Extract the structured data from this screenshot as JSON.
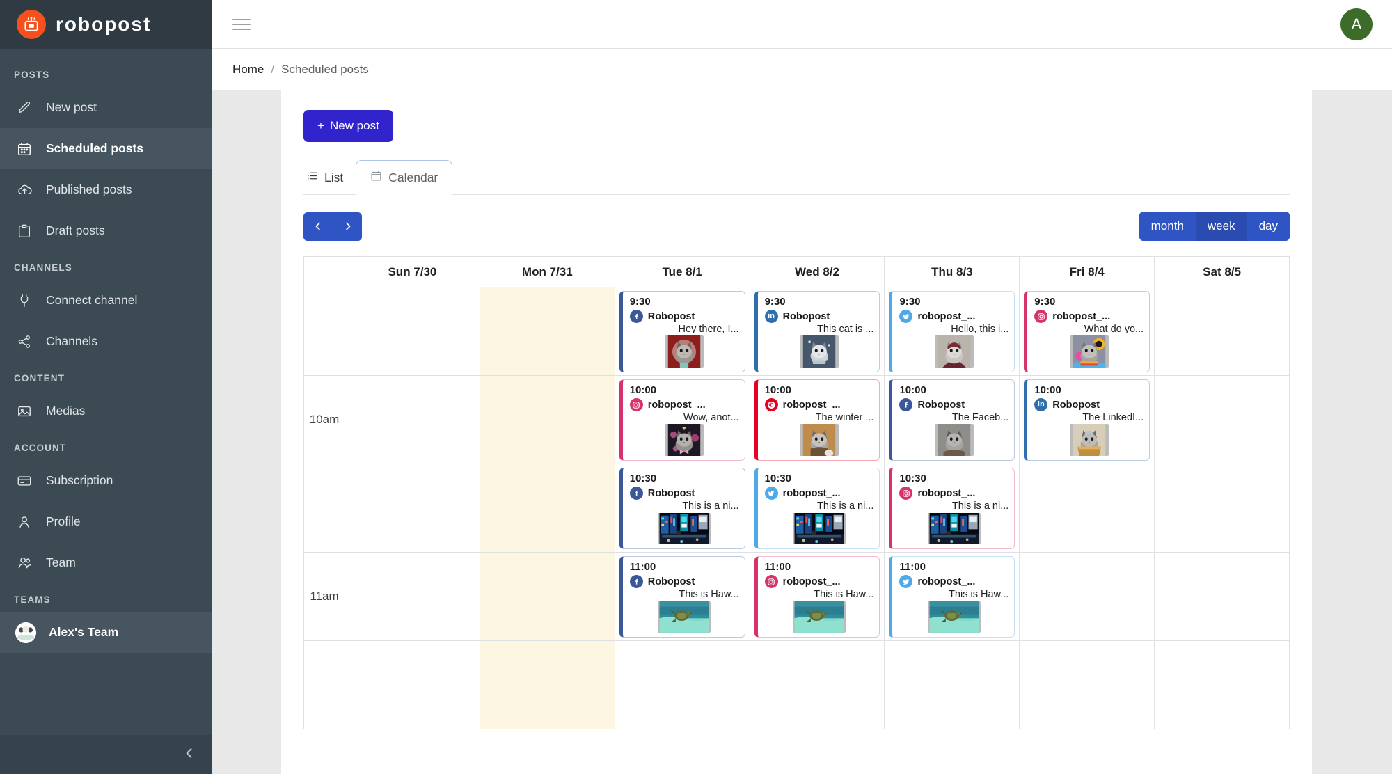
{
  "brand": {
    "name": "robopost",
    "logo_icon": "robot-logo-icon"
  },
  "sidebar": {
    "sections": [
      {
        "label": "POSTS",
        "items": [
          {
            "label": "New post",
            "icon": "pencil-icon",
            "active": false
          },
          {
            "label": "Scheduled posts",
            "icon": "calendar-icon",
            "active": true
          },
          {
            "label": "Published posts",
            "icon": "cloud-upload-icon",
            "active": false
          },
          {
            "label": "Draft posts",
            "icon": "clipboard-icon",
            "active": false
          }
        ]
      },
      {
        "label": "CHANNELS",
        "items": [
          {
            "label": "Connect channel",
            "icon": "plug-icon",
            "active": false
          },
          {
            "label": "Channels",
            "icon": "share-nodes-icon",
            "active": false
          }
        ]
      },
      {
        "label": "CONTENT",
        "items": [
          {
            "label": "Medias",
            "icon": "image-icon",
            "active": false
          }
        ]
      },
      {
        "label": "ACCOUNT",
        "items": [
          {
            "label": "Subscription",
            "icon": "credit-card-icon",
            "active": false
          },
          {
            "label": "Profile",
            "icon": "user-icon",
            "active": false
          },
          {
            "label": "Team",
            "icon": "users-icon",
            "active": false
          }
        ]
      },
      {
        "label": "TEAMS",
        "items": [
          {
            "label": "Alex's Team",
            "icon": "team-avatar-icon",
            "active": true
          }
        ]
      }
    ],
    "collapse_icon": "chevron-left-icon"
  },
  "topbar": {
    "menu_icon": "hamburger-menu-icon",
    "avatar_initial": "A",
    "avatar_color": "#3d6b2a"
  },
  "breadcrumb": {
    "home": "Home",
    "separator": "/",
    "current": "Scheduled posts"
  },
  "toolbar": {
    "new_post_label": "New post",
    "new_post_plus": "+",
    "new_post_color": "#3224cc"
  },
  "tabs": [
    {
      "label": "List",
      "icon": "list-icon",
      "active": false
    },
    {
      "label": "Calendar",
      "icon": "calendar-icon",
      "active": true
    }
  ],
  "calendar_nav": {
    "prev_icon": "chevron-left-icon",
    "next_icon": "chevron-right-icon",
    "views": [
      {
        "label": "month",
        "selected": false
      },
      {
        "label": "week",
        "selected": true
      },
      {
        "label": "day",
        "selected": false
      }
    ],
    "accent_color": "#2f55c5"
  },
  "calendar": {
    "days": [
      {
        "label": "Sun 7/30",
        "today": false
      },
      {
        "label": "Mon 7/31",
        "today": true
      },
      {
        "label": "Tue 8/1",
        "today": false
      },
      {
        "label": "Wed 8/2",
        "today": false
      },
      {
        "label": "Thu 8/3",
        "today": false
      },
      {
        "label": "Fri 8/4",
        "today": false
      },
      {
        "label": "Sat 8/5",
        "today": false
      }
    ],
    "time_labels": [
      "",
      "10am",
      "",
      "11am",
      ""
    ],
    "rows": [
      {
        "gutter": "",
        "half": false,
        "cells": [
          {
            "day": "Sun 7/30",
            "event": null
          },
          {
            "day": "Mon 7/31",
            "event": null
          },
          {
            "day": "Tue 8/1",
            "event": {
              "time": "9:30",
              "network": "facebook",
              "account": "Robopost",
              "text": "Hey there, I...",
              "thumb": "cat-red-backdrop",
              "color": "#3b5998"
            }
          },
          {
            "day": "Wed 8/2",
            "event": {
              "time": "9:30",
              "network": "linkedin",
              "account": "Robopost",
              "text": "This cat is ...",
              "thumb": "cat-snow-scarf",
              "color": "#2f6fad"
            }
          },
          {
            "day": "Thu 8/3",
            "event": {
              "time": "9:30",
              "network": "twitter",
              "account": "robopost_...",
              "text": "Hello, this i...",
              "thumb": "cat-red-robe",
              "color": "#4fa8e8"
            }
          },
          {
            "day": "Fri 8/4",
            "event": {
              "time": "9:30",
              "network": "instagram",
              "account": "robopost_...",
              "text": "What do yo...",
              "thumb": "cat-rainbow-graffiti",
              "color": "#d6336c"
            }
          },
          {
            "day": "Sat 8/5",
            "event": null
          }
        ]
      },
      {
        "gutter": "10am",
        "half": false,
        "cells": [
          {
            "day": "Sun 7/30",
            "event": null
          },
          {
            "day": "Mon 7/31",
            "event": null
          },
          {
            "day": "Tue 8/1",
            "event": {
              "time": "10:00",
              "network": "instagram",
              "account": "robopost_...",
              "text": "Wow, anot...",
              "thumb": "cat-pink-bowtie",
              "color": "#d6336c"
            }
          },
          {
            "day": "Wed 8/2",
            "event": {
              "time": "10:00",
              "network": "pinterest",
              "account": "robopost_...",
              "text": "The winter ...",
              "thumb": "cat-tan-coat",
              "color": "#e60023"
            }
          },
          {
            "day": "Thu 8/3",
            "event": {
              "time": "10:00",
              "network": "facebook",
              "account": "Robopost",
              "text": "The Faceb...",
              "thumb": "cat-grey-portrait",
              "color": "#3b5998"
            }
          },
          {
            "day": "Fri 8/4",
            "event": {
              "time": "10:00",
              "network": "linkedin",
              "account": "Robopost",
              "text": "The LinkedI...",
              "thumb": "cat-in-box",
              "color": "#2f6fad"
            }
          },
          {
            "day": "Sat 8/5",
            "event": null
          }
        ]
      },
      {
        "gutter": "",
        "half": false,
        "cells": [
          {
            "day": "Sun 7/30",
            "event": null
          },
          {
            "day": "Mon 7/31",
            "event": null
          },
          {
            "day": "Tue 8/1",
            "event": {
              "time": "10:30",
              "network": "facebook",
              "account": "Robopost",
              "text": "This is a ni...",
              "thumb": "city-neon-street",
              "color": "#3b5998"
            }
          },
          {
            "day": "Wed 8/2",
            "event": {
              "time": "10:30",
              "network": "twitter",
              "account": "robopost_...",
              "text": "This is a ni...",
              "thumb": "city-neon-street",
              "color": "#4fa8e8"
            }
          },
          {
            "day": "Thu 8/3",
            "event": {
              "time": "10:30",
              "network": "instagram",
              "account": "robopost_...",
              "text": "This is a ni...",
              "thumb": "city-neon-street",
              "color": "#d6336c"
            }
          },
          {
            "day": "Fri 8/4",
            "event": null
          },
          {
            "day": "Sat 8/5",
            "event": null
          }
        ]
      },
      {
        "gutter": "11am",
        "half": false,
        "cells": [
          {
            "day": "Sun 7/30",
            "event": null
          },
          {
            "day": "Mon 7/31",
            "event": null
          },
          {
            "day": "Tue 8/1",
            "event": {
              "time": "11:00",
              "network": "facebook",
              "account": "Robopost",
              "text": "This is Haw...",
              "thumb": "sea-turtle",
              "color": "#3b5998"
            }
          },
          {
            "day": "Wed 8/2",
            "event": {
              "time": "11:00",
              "network": "instagram",
              "account": "robopost_...",
              "text": "This is Haw...",
              "thumb": "sea-turtle",
              "color": "#d6336c"
            }
          },
          {
            "day": "Thu 8/3",
            "event": {
              "time": "11:00",
              "network": "twitter",
              "account": "robopost_...",
              "text": "This is Haw...",
              "thumb": "sea-turtle",
              "color": "#4fa8e8"
            }
          },
          {
            "day": "Fri 8/4",
            "event": null
          },
          {
            "day": "Sat 8/5",
            "event": null
          }
        ]
      },
      {
        "gutter": "",
        "half": false,
        "cells": [
          {
            "day": "Sun 7/30",
            "event": null
          },
          {
            "day": "Mon 7/31",
            "event": null
          },
          {
            "day": "Tue 8/1",
            "event": null
          },
          {
            "day": "Wed 8/2",
            "event": null
          },
          {
            "day": "Thu 8/3",
            "event": null
          },
          {
            "day": "Fri 8/4",
            "event": null
          },
          {
            "day": "Sat 8/5",
            "event": null
          }
        ]
      }
    ]
  },
  "network_colors": {
    "facebook": "#3b5998",
    "linkedin": "#2f6fad",
    "twitter": "#4fa8e8",
    "instagram": "#d6336c",
    "pinterest": "#e60023"
  }
}
